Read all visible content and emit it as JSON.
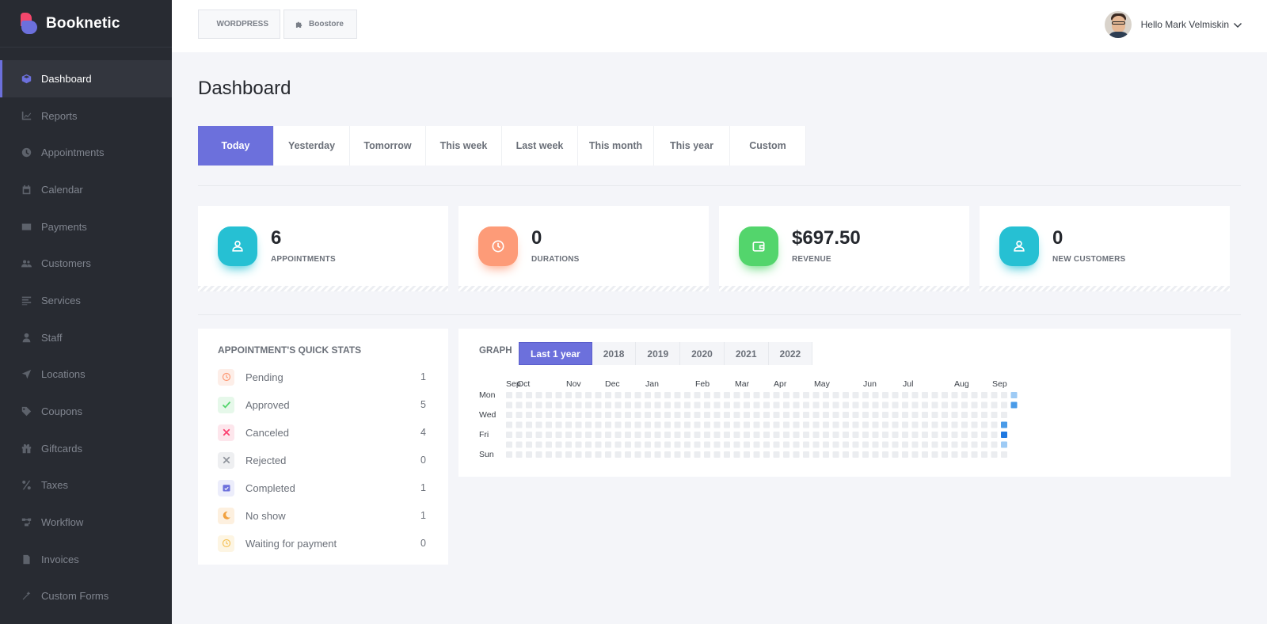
{
  "brand": {
    "name": "Booknetic"
  },
  "sidebar": {
    "items": [
      {
        "label": "Dashboard",
        "icon": "cube-icon",
        "active": true
      },
      {
        "label": "Reports",
        "icon": "chart-line-icon"
      },
      {
        "label": "Appointments",
        "icon": "clock-icon"
      },
      {
        "label": "Calendar",
        "icon": "calendar-icon"
      },
      {
        "label": "Payments",
        "icon": "credit-card-icon"
      },
      {
        "label": "Customers",
        "icon": "users-icon"
      },
      {
        "label": "Services",
        "icon": "list-icon"
      },
      {
        "label": "Staff",
        "icon": "user-icon"
      },
      {
        "label": "Locations",
        "icon": "location-arrow-icon"
      },
      {
        "label": "Coupons",
        "icon": "tag-icon"
      },
      {
        "label": "Giftcards",
        "icon": "gift-icon"
      },
      {
        "label": "Taxes",
        "icon": "percent-icon"
      },
      {
        "label": "Workflow",
        "icon": "workflow-icon"
      },
      {
        "label": "Invoices",
        "icon": "file-icon"
      },
      {
        "label": "Custom Forms",
        "icon": "magic-wand-icon"
      }
    ]
  },
  "header": {
    "crumbs": [
      "WORDPRESS",
      "Boostore"
    ],
    "user_name": "Hello Mark Velmiskin"
  },
  "page": {
    "title": "Dashboard",
    "tabs": [
      "Today",
      "Yesterday",
      "Tomorrow",
      "This week",
      "Last week",
      "This month",
      "This year",
      "Custom"
    ],
    "active_tab": "Today"
  },
  "stats": [
    {
      "value": "6",
      "label": "APPOINTMENTS",
      "color": "#26c0d3",
      "icon": "user-icon"
    },
    {
      "value": "0",
      "label": "DURATIONS",
      "color": "#fd9b78",
      "icon": "clock-icon"
    },
    {
      "value": "$697.50",
      "label": "REVENUE",
      "color": "#53d56c",
      "icon": "wallet-icon"
    },
    {
      "value": "0",
      "label": "NEW CUSTOMERS",
      "color": "#26c0d3",
      "icon": "user-icon"
    }
  ],
  "quick_stats": {
    "title": "APPOINTMENT'S QUICK STATS",
    "rows": [
      {
        "label": "Pending",
        "count": "1",
        "icon": "clock-icon",
        "color": "#fd9b78",
        "bg": "#fdeee8"
      },
      {
        "label": "Approved",
        "count": "5",
        "icon": "check-icon",
        "color": "#53d56c",
        "bg": "#e6f8ea"
      },
      {
        "label": "Canceled",
        "count": "4",
        "icon": "times-icon",
        "color": "#fb3e6e",
        "bg": "#fde6ec"
      },
      {
        "label": "Rejected",
        "count": "0",
        "icon": "times-icon",
        "color": "#8e939b",
        "bg": "#eeeff1"
      },
      {
        "label": "Completed",
        "count": "1",
        "icon": "calendar-check-icon",
        "color": "#6c70dc",
        "bg": "#ecedfb"
      },
      {
        "label": "No show",
        "count": "1",
        "icon": "moon-icon",
        "color": "#f1a13f",
        "bg": "#fdf0df"
      },
      {
        "label": "Waiting for payment",
        "count": "0",
        "icon": "clock-icon",
        "color": "#f6c35b",
        "bg": "#fdf5e3"
      }
    ]
  },
  "graph": {
    "label": "GRAPH",
    "years": [
      "Last 1 year",
      "2018",
      "2019",
      "2020",
      "2021",
      "2022"
    ],
    "active_year": "Last 1 year",
    "months": [
      "Sep",
      "Oct",
      "Nov",
      "Dec",
      "Jan",
      "Feb",
      "Mar",
      "Apr",
      "May",
      "Jun",
      "Jul",
      "Aug",
      "Sep"
    ],
    "day_labels": [
      "Mon",
      "Wed",
      "Fri",
      "Sun"
    ],
    "colors": {
      "empty": "#ebedf0",
      "low": "#9ecbf5",
      "mid": "#4a9be8",
      "high": "#1f78e0"
    },
    "highlight_cells": [
      {
        "week": 51,
        "day": 0,
        "level": "low"
      },
      {
        "week": 51,
        "day": 1,
        "level": "mid"
      },
      {
        "week": 50,
        "day": 3,
        "level": "mid"
      },
      {
        "week": 50,
        "day": 4,
        "level": "high"
      },
      {
        "week": 50,
        "day": 5,
        "level": "low"
      }
    ]
  }
}
